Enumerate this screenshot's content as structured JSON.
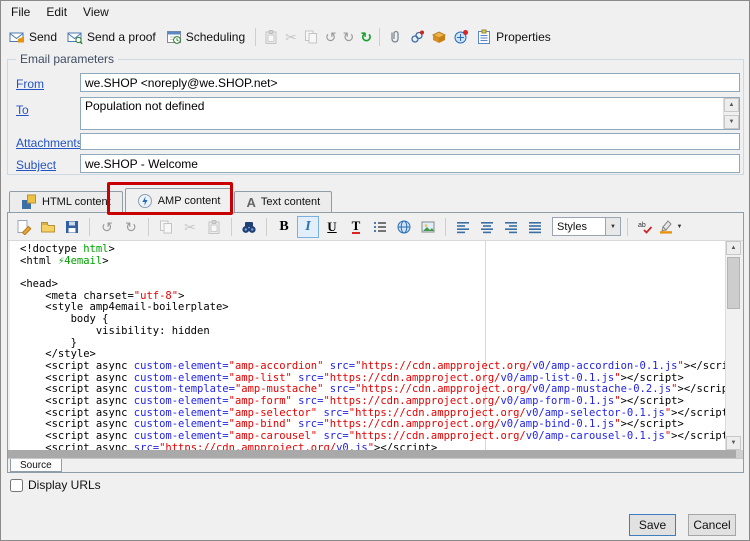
{
  "menu": {
    "items": [
      {
        "label": "File"
      },
      {
        "label": "Edit"
      },
      {
        "label": "View"
      }
    ]
  },
  "toolbar": {
    "send": "Send",
    "send_proof": "Send a proof",
    "scheduling": "Scheduling",
    "properties": "Properties"
  },
  "params": {
    "group_label": "Email parameters",
    "from_label": "From",
    "from_value": "we.SHOP <noreply@we.SHOP.net>",
    "to_label": "To",
    "to_value": "Population not defined",
    "attachments_label": "Attachments",
    "attachments_value": "",
    "subject_label": "Subject",
    "subject_value": "we.SHOP - Welcome"
  },
  "tabs": {
    "html": "HTML content",
    "amp": "AMP content",
    "text": "Text content"
  },
  "annotation": {
    "color": "#c80000"
  },
  "editor_toolbar": {
    "bold": "B",
    "italic": "I",
    "underline": "U",
    "text_color": "T",
    "styles": "Styles"
  },
  "code": {
    "colors": {
      "k": "#000000",
      "g": "#00a000",
      "r": "#e60000",
      "b": "#2323e6"
    },
    "lines": [
      [
        [
          "<!doctype ",
          "k"
        ],
        [
          "html",
          "g"
        ],
        [
          ">",
          "k"
        ]
      ],
      [
        [
          "<html ",
          "k"
        ],
        [
          "⚡4email",
          "g"
        ],
        [
          ">",
          "k"
        ]
      ],
      [],
      [
        [
          "<head>",
          "k"
        ]
      ],
      [
        [
          "    <meta charset=",
          "k"
        ],
        [
          "\"utf-8\"",
          "r"
        ],
        [
          ">",
          "k"
        ]
      ],
      [
        [
          "    <style amp4email-boilerplate>",
          "k"
        ]
      ],
      [
        [
          "        body {",
          "k"
        ]
      ],
      [
        [
          "            visibility: hidden",
          "k"
        ]
      ],
      [
        [
          "        }",
          "k"
        ]
      ],
      [
        [
          "    </style>",
          "k"
        ]
      ],
      [
        [
          "    <script async ",
          "k"
        ],
        [
          "custom-element=",
          "b"
        ],
        [
          "\"amp-accordion\"",
          "r"
        ],
        [
          " src=",
          "b"
        ],
        [
          "\"https://cdn.ampproject.org/",
          "r"
        ],
        [
          "v0/amp-accordion-0.1.js",
          "b"
        ],
        [
          "\"",
          "r"
        ],
        [
          "></script>",
          "k"
        ]
      ],
      [
        [
          "    <script async ",
          "k"
        ],
        [
          "custom-element=",
          "b"
        ],
        [
          "\"amp-list\"",
          "r"
        ],
        [
          " src=",
          "b"
        ],
        [
          "\"https://cdn.ampproject.org/",
          "r"
        ],
        [
          "v0/amp-list-0.1.js",
          "b"
        ],
        [
          "\"",
          "r"
        ],
        [
          "></script>",
          "k"
        ]
      ],
      [
        [
          "    <script async ",
          "k"
        ],
        [
          "custom-template=",
          "b"
        ],
        [
          "\"amp-mustache\"",
          "r"
        ],
        [
          " src=",
          "b"
        ],
        [
          "\"https://cdn.ampproject.org/",
          "r"
        ],
        [
          "v0/amp-mustache-0.2.js",
          "b"
        ],
        [
          "\"",
          "r"
        ],
        [
          "></script>",
          "k"
        ]
      ],
      [
        [
          "    <script async ",
          "k"
        ],
        [
          "custom-element=",
          "b"
        ],
        [
          "\"amp-form\"",
          "r"
        ],
        [
          " src=",
          "b"
        ],
        [
          "\"https://cdn.ampproject.org/",
          "r"
        ],
        [
          "v0/amp-form-0.1.js",
          "b"
        ],
        [
          "\"",
          "r"
        ],
        [
          "></script>",
          "k"
        ]
      ],
      [
        [
          "    <script async ",
          "k"
        ],
        [
          "custom-element=",
          "b"
        ],
        [
          "\"amp-selector\"",
          "r"
        ],
        [
          " src=",
          "b"
        ],
        [
          "\"https://cdn.ampproject.org/",
          "r"
        ],
        [
          "v0/amp-selector-0.1.js",
          "b"
        ],
        [
          "\"",
          "r"
        ],
        [
          "></script>",
          "k"
        ]
      ],
      [
        [
          "    <script async ",
          "k"
        ],
        [
          "custom-element=",
          "b"
        ],
        [
          "\"amp-bind\"",
          "r"
        ],
        [
          " src=",
          "b"
        ],
        [
          "\"https://cdn.ampproject.org/",
          "r"
        ],
        [
          "v0/amp-bind-0.1.js",
          "b"
        ],
        [
          "\"",
          "r"
        ],
        [
          "></script>",
          "k"
        ]
      ],
      [
        [
          "    <script async ",
          "k"
        ],
        [
          "custom-element=",
          "b"
        ],
        [
          "\"amp-carousel\"",
          "r"
        ],
        [
          " src=",
          "b"
        ],
        [
          "\"https://cdn.ampproject.org/",
          "r"
        ],
        [
          "v0/amp-carousel-0.1.js",
          "b"
        ],
        [
          "\"",
          "r"
        ],
        [
          "></script>",
          "k"
        ]
      ],
      [
        [
          "    <script async ",
          "k"
        ],
        [
          "src=",
          "b"
        ],
        [
          "\"https://cdn.ampproject.org/",
          "r"
        ],
        [
          "v0.js",
          "b"
        ],
        [
          "\"",
          "r"
        ],
        [
          "></script>",
          "k"
        ]
      ]
    ]
  },
  "bottom": {
    "source_tab": "Source",
    "display_urls": "Display URLs"
  },
  "actions": {
    "save": "Save",
    "cancel": "Cancel"
  }
}
